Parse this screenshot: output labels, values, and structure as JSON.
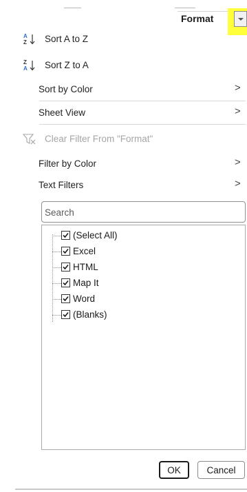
{
  "header": {
    "cell_text": "Format",
    "dropdown_icon": "dropdown-arrow-icon",
    "highlight_color": "#ffff3a"
  },
  "menu": {
    "sort_a_to_z": "Sort A to Z",
    "sort_z_to_a": "Sort Z to A",
    "sort_by_color": "Sort by Color",
    "sheet_view": "Sheet View",
    "clear_filter": "Clear Filter From \"Format\"",
    "filter_by_color": "Filter by Color",
    "text_filters": "Text Filters",
    "chevron": ">"
  },
  "search": {
    "placeholder": "Search"
  },
  "list": {
    "items": [
      {
        "label": "(Select All)",
        "checked": true
      },
      {
        "label": "Excel",
        "checked": true
      },
      {
        "label": "HTML",
        "checked": true
      },
      {
        "label": "Map It",
        "checked": true
      },
      {
        "label": "Word",
        "checked": true
      },
      {
        "label": "(Blanks)",
        "checked": true
      }
    ]
  },
  "buttons": {
    "ok": "OK",
    "cancel": "Cancel"
  },
  "colors": {
    "sort_icon_blue": "#2b6fc2",
    "disabled_text": "#a6a6a6"
  }
}
